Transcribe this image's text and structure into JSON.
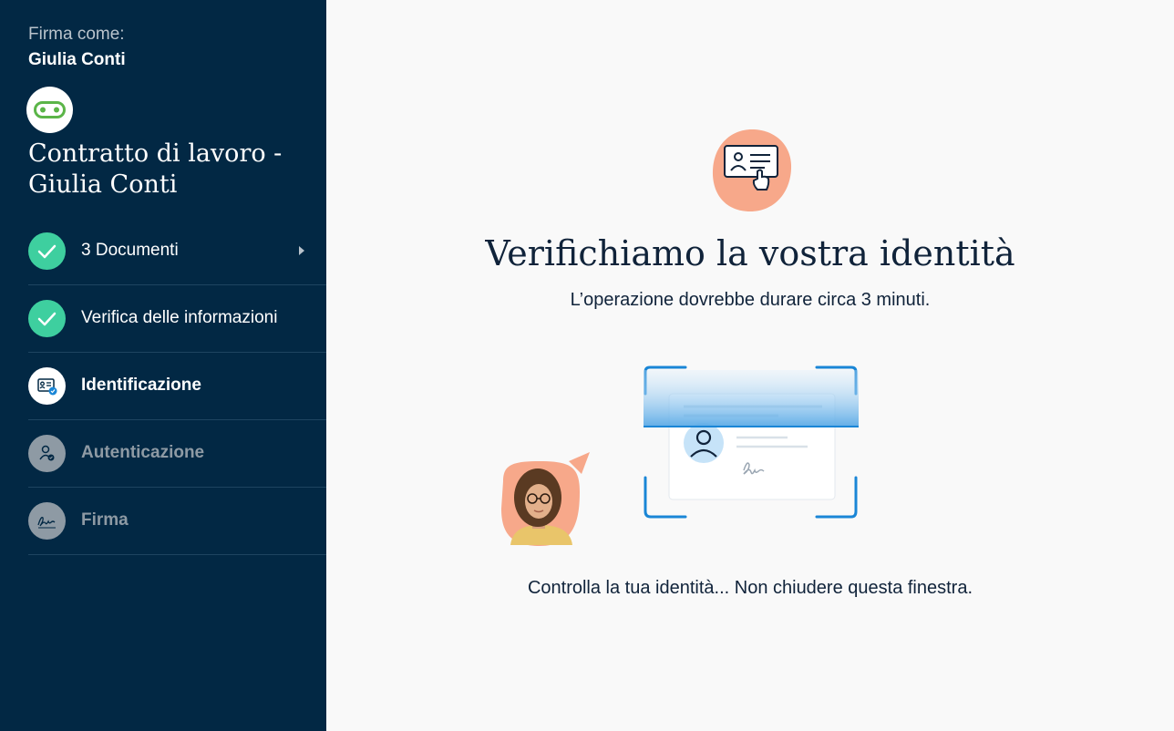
{
  "sidebar": {
    "signer_label": "Firma come:",
    "signer_name": "Giulia Conti",
    "document_title": "Contratto di lavoro - Giulia Conti",
    "steps": [
      {
        "label": "3 Documenti",
        "state": "completed"
      },
      {
        "label": "Verifica delle informazioni",
        "state": "completed"
      },
      {
        "label": "Identificazione",
        "state": "active"
      },
      {
        "label": "Autenticazione",
        "state": "disabled"
      },
      {
        "label": "Firma",
        "state": "disabled"
      }
    ]
  },
  "main": {
    "heading": "Verifichiamo la vostra identità",
    "subheading": "L’operazione dovrebbe durare circa 3 minuti.",
    "status": "Controlla la tua identità... Non chiudere questa finestra."
  },
  "colors": {
    "sidebar_bg": "#022844",
    "completed_green": "#3ecf9f",
    "scan_blue": "#1a86d6",
    "accent_peach": "#f7a88a"
  }
}
